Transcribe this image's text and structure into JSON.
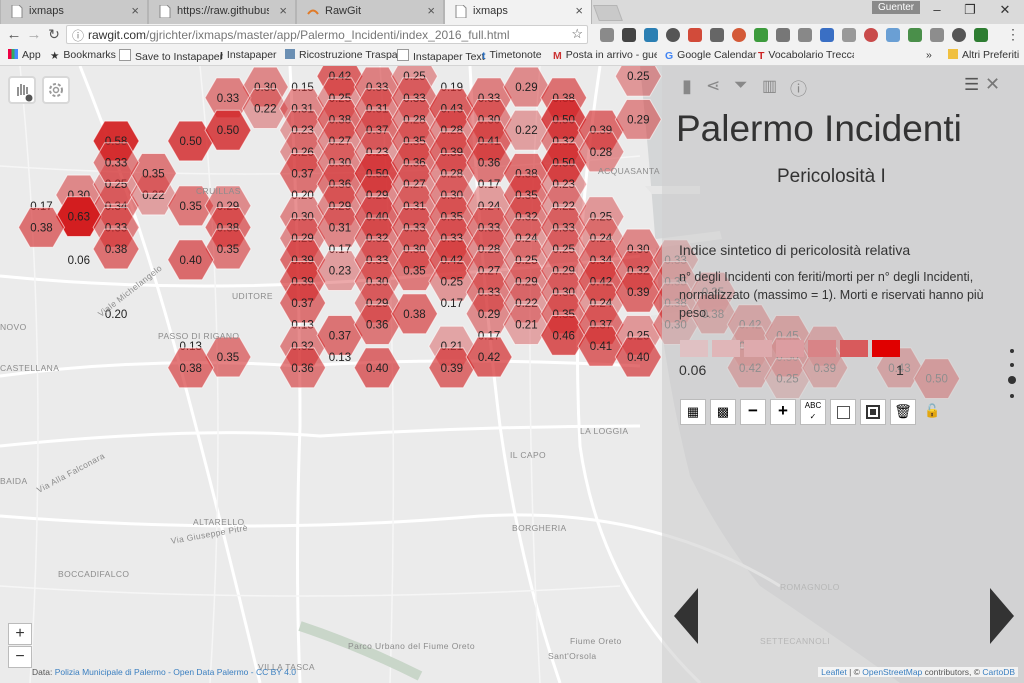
{
  "browser": {
    "tabs": [
      {
        "title": "ixmaps",
        "active": false
      },
      {
        "title": "https://raw.githubuserco",
        "active": false
      },
      {
        "title": "RawGit",
        "active": false
      },
      {
        "title": "ixmaps",
        "active": true
      }
    ],
    "profile_name": "Guenter",
    "url_host": "rawgit.com",
    "url_path": "/gjrichter/ixmaps/master/app/Palermo_Incidenti/index_2016_full.html",
    "bookmarks": [
      "App",
      "Bookmarks",
      "Save to Instapaper",
      "Instapaper",
      "Ricostruzione Traspar",
      "Instapaper Text",
      "Timetonote",
      "Posta in arrivo - guer",
      "Google Calendar",
      "Vocabolario Treccani"
    ],
    "bookmarks_more": "»",
    "other_bookmarks": "Altri Preferiti"
  },
  "panel": {
    "title": "Palermo Incidenti",
    "subtitle": "Pericolosità I",
    "heading": "Indice sintetico di pericolosità relativa",
    "description": "n° degli Incidenti con feriti/morti per n° degli Incidenti, normalizzato (massimo = 1). Morti e riservati hanno più peso.",
    "legend_min": "0.06",
    "legend_max": "1",
    "legend_colors": [
      "#e0c1c3",
      "#e0b6b8",
      "#deaaad",
      "#dc9da1",
      "#d88487",
      "#d85a5c",
      "#e00000"
    ]
  },
  "map": {
    "place_names": [
      "CRUILLAS",
      "UDITORE",
      "NOVO",
      "CASTELLANA",
      "PASSO DI RIGANO",
      "BAIDA",
      "ALTARELLO",
      "BOCCADIFALCO",
      "ACQUASANTA",
      "LA LOGGIA",
      "IL CAPO",
      "BORGHERIA",
      "Sant'Orsola",
      "Parco Urbano del Fiume Oreto",
      "Fiume Oreto",
      "GUADAGNA",
      "SETTECANNOLI",
      "ROMAGNOLO",
      "VILLA TASCA",
      "Via Alla Falconara",
      "Viale Michelangelo",
      "Via Giuseppe Pitrè"
    ],
    "hexagons": [
      {
        "c": 1,
        "r": 0,
        "v": "0.30"
      },
      {
        "c": 0,
        "r": 1,
        "v": "0.33"
      },
      {
        "c": 1,
        "r": 2,
        "v": "0.22"
      },
      {
        "c": 2,
        "r": 0,
        "v": "0.15"
      },
      {
        "c": 2,
        "r": 2,
        "v": "0.31"
      },
      {
        "c": 2,
        "r": 4,
        "v": "0.23"
      },
      {
        "c": 2,
        "r": 6,
        "v": "0.26"
      },
      {
        "c": 2,
        "r": 8,
        "v": "0.37"
      },
      {
        "c": 2,
        "r": 10,
        "v": "0.20"
      },
      {
        "c": 2,
        "r": 12,
        "v": "0.30"
      },
      {
        "c": 2,
        "r": 14,
        "v": "0.29"
      },
      {
        "c": 2,
        "r": 16,
        "v": "0.39"
      },
      {
        "c": 2,
        "r": 18,
        "v": "0.39"
      },
      {
        "c": 2,
        "r": 20,
        "v": "0.37"
      },
      {
        "c": 2,
        "r": 22,
        "v": "0.13"
      },
      {
        "c": 2,
        "r": 24,
        "v": "0.32"
      },
      {
        "c": 2,
        "r": 26,
        "v": "0.36"
      },
      {
        "c": 3,
        "r": -1,
        "v": "0.42"
      },
      {
        "c": 3,
        "r": 1,
        "v": "0.25"
      },
      {
        "c": 3,
        "r": 3,
        "v": "0.38"
      },
      {
        "c": 3,
        "r": 5,
        "v": "0.27"
      },
      {
        "c": 3,
        "r": 7,
        "v": "0.30"
      },
      {
        "c": 3,
        "r": 9,
        "v": "0.36"
      },
      {
        "c": 3,
        "r": 11,
        "v": "0.29"
      },
      {
        "c": 3,
        "r": 13,
        "v": "0.31"
      },
      {
        "c": 3,
        "r": 15,
        "v": "0.17"
      },
      {
        "c": 3,
        "r": 17,
        "v": "0.23"
      },
      {
        "c": 3,
        "r": 23,
        "v": "0.37"
      },
      {
        "c": 3,
        "r": 25,
        "v": "0.13"
      },
      {
        "c": 4,
        "r": 0,
        "v": "0.33"
      },
      {
        "c": 4,
        "r": 2,
        "v": "0.31"
      },
      {
        "c": 4,
        "r": 4,
        "v": "0.37"
      },
      {
        "c": 4,
        "r": 6,
        "v": "0.23"
      },
      {
        "c": 4,
        "r": 8,
        "v": "0.50"
      },
      {
        "c": 4,
        "r": 10,
        "v": "0.29"
      },
      {
        "c": 4,
        "r": 12,
        "v": "0.40"
      },
      {
        "c": 4,
        "r": 14,
        "v": "0.32"
      },
      {
        "c": 4,
        "r": 16,
        "v": "0.33"
      },
      {
        "c": 4,
        "r": 18,
        "v": "0.30"
      },
      {
        "c": 4,
        "r": 20,
        "v": "0.29"
      },
      {
        "c": 4,
        "r": 22,
        "v": "0.36"
      },
      {
        "c": 4,
        "r": 26,
        "v": "0.40"
      },
      {
        "c": 5,
        "r": -1,
        "v": "0.25"
      },
      {
        "c": 5,
        "r": 1,
        "v": "0.33"
      },
      {
        "c": 5,
        "r": 3,
        "v": "0.28"
      },
      {
        "c": 5,
        "r": 5,
        "v": "0.35"
      },
      {
        "c": 5,
        "r": 7,
        "v": "0.36"
      },
      {
        "c": 5,
        "r": 9,
        "v": "0.27"
      },
      {
        "c": 5,
        "r": 11,
        "v": "0.31"
      },
      {
        "c": 5,
        "r": 13,
        "v": "0.33"
      },
      {
        "c": 5,
        "r": 15,
        "v": "0.30"
      },
      {
        "c": 5,
        "r": 17,
        "v": "0.35"
      },
      {
        "c": 5,
        "r": 21,
        "v": "0.38"
      },
      {
        "c": 6,
        "r": 0,
        "v": "0.19"
      },
      {
        "c": 6,
        "r": 2,
        "v": "0.43"
      },
      {
        "c": 6,
        "r": 4,
        "v": "0.28"
      },
      {
        "c": 6,
        "r": 6,
        "v": "0.39"
      },
      {
        "c": 6,
        "r": 8,
        "v": "0.28"
      },
      {
        "c": 6,
        "r": 10,
        "v": "0.30"
      },
      {
        "c": 6,
        "r": 12,
        "v": "0.35"
      },
      {
        "c": 6,
        "r": 14,
        "v": "0.33"
      },
      {
        "c": 6,
        "r": 16,
        "v": "0.42"
      },
      {
        "c": 6,
        "r": 18,
        "v": "0.25"
      },
      {
        "c": 6,
        "r": 20,
        "v": "0.17"
      },
      {
        "c": 6,
        "r": 24,
        "v": "0.21"
      },
      {
        "c": 6,
        "r": 26,
        "v": "0.39"
      },
      {
        "c": 7,
        "r": 1,
        "v": "0.33"
      },
      {
        "c": 7,
        "r": 3,
        "v": "0.30"
      },
      {
        "c": 7,
        "r": 5,
        "v": "0.41"
      },
      {
        "c": 7,
        "r": 7,
        "v": "0.36"
      },
      {
        "c": 7,
        "r": 9,
        "v": "0.17"
      },
      {
        "c": 7,
        "r": 11,
        "v": "0.24"
      },
      {
        "c": 7,
        "r": 13,
        "v": "0.33"
      },
      {
        "c": 7,
        "r": 15,
        "v": "0.28"
      },
      {
        "c": 7,
        "r": 17,
        "v": "0.27"
      },
      {
        "c": 7,
        "r": 19,
        "v": "0.33"
      },
      {
        "c": 7,
        "r": 21,
        "v": "0.29"
      },
      {
        "c": 7,
        "r": 23,
        "v": "0.17"
      },
      {
        "c": 7,
        "r": 25,
        "v": "0.42"
      },
      {
        "c": 8,
        "r": 0,
        "v": "0.29"
      },
      {
        "c": 8,
        "r": 4,
        "v": "0.22"
      },
      {
        "c": 8,
        "r": 8,
        "v": "0.38"
      },
      {
        "c": 8,
        "r": 10,
        "v": "0.35"
      },
      {
        "c": 8,
        "r": 12,
        "v": "0.32"
      },
      {
        "c": 8,
        "r": 14,
        "v": "0.24"
      },
      {
        "c": 8,
        "r": 16,
        "v": "0.25"
      },
      {
        "c": 8,
        "r": 18,
        "v": "0.29"
      },
      {
        "c": 8,
        "r": 20,
        "v": "0.22"
      },
      {
        "c": 8,
        "r": 22,
        "v": "0.21"
      },
      {
        "c": 9,
        "r": 1,
        "v": "0.38"
      },
      {
        "c": 9,
        "r": 3,
        "v": "0.50"
      },
      {
        "c": 9,
        "r": 5,
        "v": "0.32"
      },
      {
        "c": 9,
        "r": 7,
        "v": "0.50"
      },
      {
        "c": 9,
        "r": 9,
        "v": "0.23"
      },
      {
        "c": 9,
        "r": 11,
        "v": "0.22"
      },
      {
        "c": 9,
        "r": 13,
        "v": "0.33"
      },
      {
        "c": 9,
        "r": 15,
        "v": "0.25"
      },
      {
        "c": 9,
        "r": 17,
        "v": "0.29"
      },
      {
        "c": 9,
        "r": 19,
        "v": "0.30"
      },
      {
        "c": 9,
        "r": 21,
        "v": "0.35"
      },
      {
        "c": 9,
        "r": 23,
        "v": "0.46"
      },
      {
        "c": 10,
        "r": 4,
        "v": "0.39"
      },
      {
        "c": 10,
        "r": 6,
        "v": "0.28"
      },
      {
        "c": 10,
        "r": 12,
        "v": "0.25"
      },
      {
        "c": 10,
        "r": 14,
        "v": "0.24"
      },
      {
        "c": 10,
        "r": 16,
        "v": "0.34"
      },
      {
        "c": 10,
        "r": 18,
        "v": "0.42"
      },
      {
        "c": 10,
        "r": 20,
        "v": "0.24"
      },
      {
        "c": 10,
        "r": 22,
        "v": "0.37"
      },
      {
        "c": 10,
        "r": 24,
        "v": "0.41"
      },
      {
        "c": 11,
        "r": -1,
        "v": "0.25"
      },
      {
        "c": 11,
        "r": 3,
        "v": "0.29"
      },
      {
        "c": 11,
        "r": 15,
        "v": "0.30"
      },
      {
        "c": 11,
        "r": 17,
        "v": "0.32"
      },
      {
        "c": 11,
        "r": 19,
        "v": "0.39"
      },
      {
        "c": 11,
        "r": 23,
        "v": "0.25"
      },
      {
        "c": 11,
        "r": 25,
        "v": "0.40"
      },
      {
        "c": 12,
        "r": 16,
        "v": "0.33"
      },
      {
        "c": 12,
        "r": 18,
        "v": "0.35"
      },
      {
        "c": 12,
        "r": 20,
        "v": "0.38"
      },
      {
        "c": 12,
        "r": 22,
        "v": "0.30"
      },
      {
        "c": 13,
        "r": 19,
        "v": "0.35"
      },
      {
        "c": 13,
        "r": 21,
        "v": "0.38"
      },
      {
        "c": 14,
        "r": 22,
        "v": "0.42"
      },
      {
        "c": 14,
        "r": 24,
        "v": "0.33"
      },
      {
        "c": 14,
        "r": 26,
        "v": "0.42"
      },
      {
        "c": 15,
        "r": 23,
        "v": "0.45"
      },
      {
        "c": 15,
        "r": 25,
        "v": "0.50"
      },
      {
        "c": 15,
        "r": 27,
        "v": "0.25"
      },
      {
        "c": 16,
        "r": 24,
        "v": "0.42"
      },
      {
        "c": 16,
        "r": 26,
        "v": "0.39"
      },
      {
        "c": 18,
        "r": 26,
        "v": "0.43"
      },
      {
        "c": 19,
        "r": 27,
        "v": "0.50"
      },
      {
        "c": -5,
        "r": 11,
        "v": "0.17"
      },
      {
        "c": -4,
        "r": 10,
        "v": "0.30"
      },
      {
        "c": -3,
        "r": 11,
        "v": "0.34"
      },
      {
        "c": -3,
        "r": 9,
        "v": "0.25"
      },
      {
        "c": -2,
        "r": 10,
        "v": "0.22"
      },
      {
        "c": -1,
        "r": 11,
        "v": "0.35"
      },
      {
        "c": -2,
        "r": 8,
        "v": "0.35"
      },
      {
        "c": -3,
        "r": 5,
        "v": "0.58"
      },
      {
        "c": -1,
        "r": 5,
        "v": "0.50"
      },
      {
        "c": 0,
        "r": 4,
        "v": "0.50"
      },
      {
        "c": -3,
        "r": 7,
        "v": "0.33"
      },
      {
        "c": -4,
        "r": 12,
        "v": "0.63"
      },
      {
        "c": -5,
        "r": 13,
        "v": "0.38"
      },
      {
        "c": -3,
        "r": 13,
        "v": "0.33"
      },
      {
        "c": -3,
        "r": 15,
        "v": "0.38"
      },
      {
        "c": -4,
        "r": 16,
        "v": "0.06"
      },
      {
        "c": 0,
        "r": 11,
        "v": "0.29"
      },
      {
        "c": 0,
        "r": 13,
        "v": "0.38"
      },
      {
        "c": 0,
        "r": 15,
        "v": "0.35"
      },
      {
        "c": -1,
        "r": 16,
        "v": "0.40"
      },
      {
        "c": -3,
        "r": 21,
        "v": "0.20"
      },
      {
        "c": -1,
        "r": 24,
        "v": "0.13"
      },
      {
        "c": 0,
        "r": 25,
        "v": "0.35"
      },
      {
        "c": -1,
        "r": 26,
        "v": "0.38"
      }
    ]
  },
  "attribution_left": {
    "prefix": "Data: ",
    "source": "Polizia Municipale di Palermo - Open Data Palermo - CC BY 4.0"
  },
  "attribution_right": {
    "leaflet": "Leaflet",
    "sep": " | © ",
    "osm": "OpenStreetMap",
    "rest": " contributors, © ",
    "cartodb": "CartoDB"
  }
}
